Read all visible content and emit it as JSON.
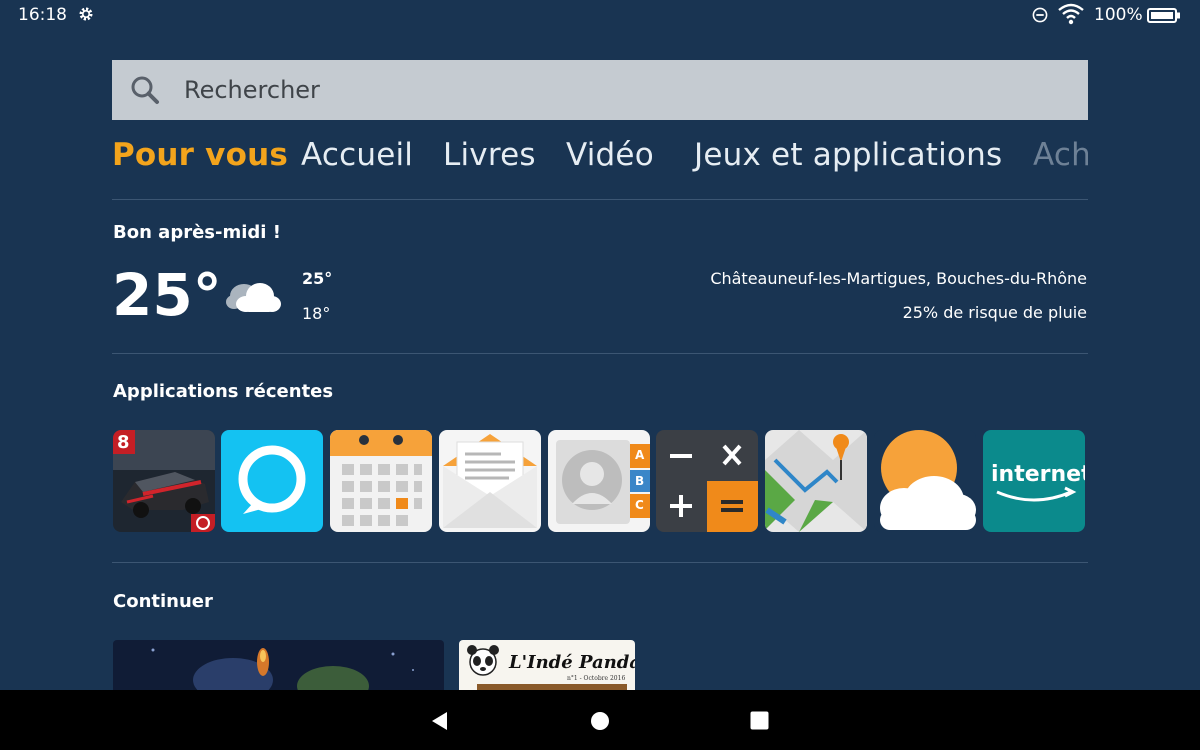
{
  "status_bar": {
    "time": "16:18",
    "battery": "100%",
    "icons": [
      "settings-icon",
      "do-not-disturb-icon",
      "wifi-icon",
      "battery-icon"
    ]
  },
  "search": {
    "placeholder": "Rechercher"
  },
  "tabs": [
    {
      "label": "Pour vous",
      "active": true
    },
    {
      "label": "Accueil"
    },
    {
      "label": "Livres"
    },
    {
      "label": "Vidéo"
    },
    {
      "label": "Jeux et applications"
    },
    {
      "label": "Ach"
    }
  ],
  "weather": {
    "greeting": "Bon après-midi !",
    "current": "25°",
    "high": "25°",
    "low": "18°",
    "location": "Châteauneuf-les-Martigues, Bouches-du-Rhône",
    "rain": "25% de risque de pluie",
    "icon": "cloud-icon"
  },
  "recent_apps": {
    "title": "Applications récentes",
    "apps": [
      {
        "name": "asphalt-8",
        "icon": "racing-game-icon",
        "badge": "8"
      },
      {
        "name": "alexa",
        "icon": "alexa-icon"
      },
      {
        "name": "calendar",
        "icon": "calendar-icon"
      },
      {
        "name": "email",
        "icon": "email-icon"
      },
      {
        "name": "contacts",
        "icon": "contacts-icon",
        "letters": [
          "A",
          "B",
          "C"
        ]
      },
      {
        "name": "calculator",
        "icon": "calculator-icon"
      },
      {
        "name": "maps",
        "icon": "map-icon"
      },
      {
        "name": "weather",
        "icon": "weather-icon"
      },
      {
        "name": "internet",
        "icon": "internet-icon",
        "label": "internet"
      }
    ]
  },
  "continue": {
    "title": "Continuer",
    "items": [
      {
        "name": "video-thumbnail"
      },
      {
        "name": "book-cover",
        "title": "L'Indé Panda",
        "subtitle": "n°1 - Octobre 2016"
      }
    ]
  },
  "colors": {
    "background": "#193452",
    "accent": "#f3a41c",
    "search_bg": "#c5cbd1",
    "nav_bar": "#000000"
  }
}
